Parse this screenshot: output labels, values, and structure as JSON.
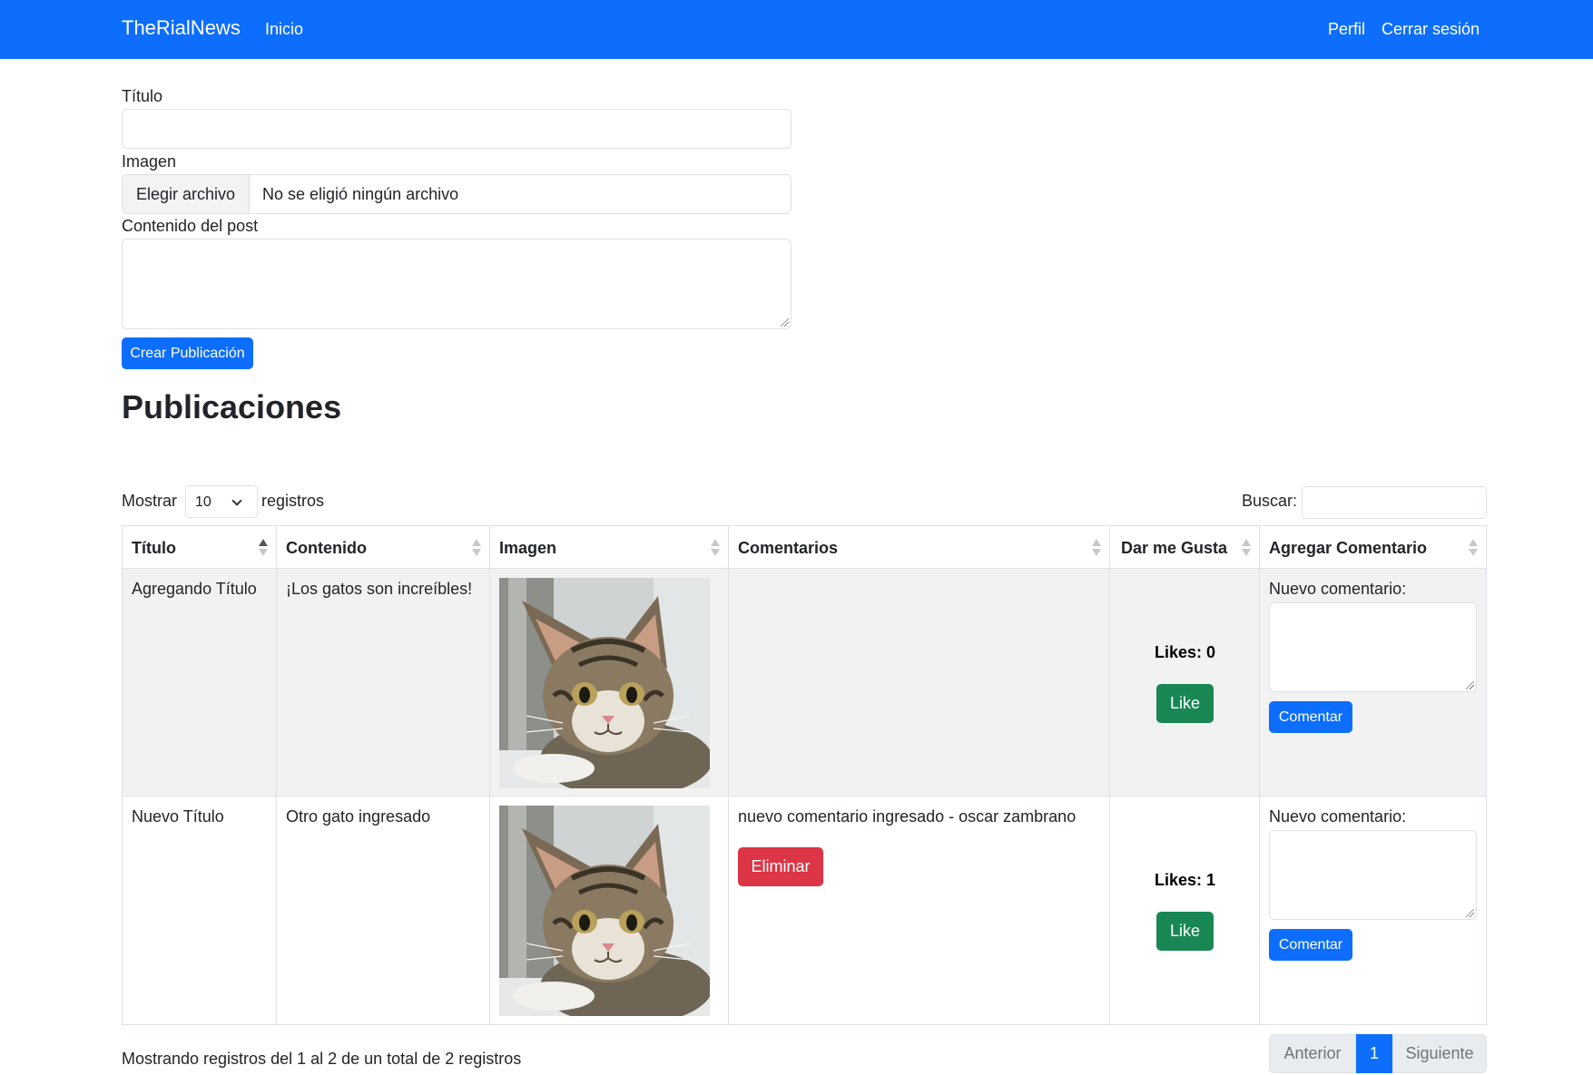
{
  "navbar": {
    "brand": "TheRialNews",
    "inicio": "Inicio",
    "perfil": "Perfil",
    "cerrar_sesion": "Cerrar sesión"
  },
  "form": {
    "titulo_label": "Título",
    "imagen_label": "Imagen",
    "file_button": "Elegir archivo",
    "file_status": "No se eligió ningún archivo",
    "contenido_label": "Contenido del post",
    "submit": "Crear Publicación"
  },
  "section_title": "Publicaciones",
  "table_controls": {
    "show_label": "Mostrar",
    "page_length": "10",
    "records_label": "registros",
    "search_label": "Buscar:"
  },
  "table": {
    "columns": [
      "Título",
      "Contenido",
      "Imagen",
      "Comentarios",
      "Dar me Gusta",
      "Agregar Comentario"
    ],
    "sorted_column": "Título",
    "sort_direction": "asc",
    "rows": [
      {
        "titulo": "Agregando Título",
        "contenido": "¡Los gatos son increíbles!",
        "imagen": "kitten-photo",
        "comentario": "",
        "likes": "Likes: 0",
        "like_button": "Like",
        "nuevo_comentario_label": "Nuevo comentario:",
        "comentar_button": "Comentar"
      },
      {
        "titulo": "Nuevo Título",
        "contenido": "Otro gato ingresado",
        "imagen": "kitten-photo",
        "comentario": "nuevo comentario ingresado - oscar zambrano",
        "eliminar_button": "Eliminar",
        "likes": "Likes: 1",
        "like_button": "Like",
        "nuevo_comentario_label": "Nuevo comentario:",
        "comentar_button": "Comentar"
      }
    ]
  },
  "footer": {
    "info": "Mostrando registros del 1 al 2 de un total de 2 registros",
    "prev": "Anterior",
    "current_page": "1",
    "next": "Siguiente"
  },
  "colors": {
    "primary": "#0d6efd",
    "success": "#198754",
    "danger": "#dc3545",
    "striped_row": "#f2f2f2"
  }
}
